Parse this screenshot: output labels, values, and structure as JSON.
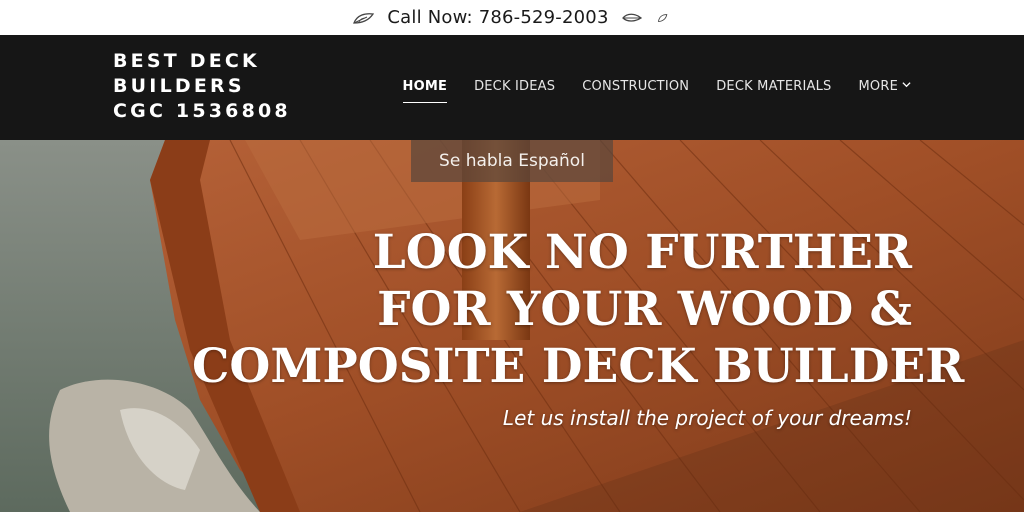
{
  "topbar": {
    "call_text": "Call Now: 786-529-2003",
    "icons": [
      "leaf-icon",
      "leaf-icon"
    ]
  },
  "header": {
    "brand_lines": [
      "BEST DECK",
      "BUILDERS",
      "CGC 1536808"
    ],
    "nav": [
      {
        "label": "HOME",
        "active": true
      },
      {
        "label": "DECK IDEAS",
        "active": false
      },
      {
        "label": "CONSTRUCTION",
        "active": false
      },
      {
        "label": "DECK MATERIALS",
        "active": false
      },
      {
        "label": "MORE",
        "active": false
      }
    ],
    "background_color": "#161616"
  },
  "hero": {
    "badge": "Se habla Español",
    "headline_lines": [
      "LOOK NO FURTHER",
      "FOR YOUR WOOD &",
      "COMPOSITE DECK BUILDER"
    ],
    "tagline": "Let us install the project of your dreams!",
    "wood_color": "#a3522a",
    "water_color": "#7c8378"
  }
}
